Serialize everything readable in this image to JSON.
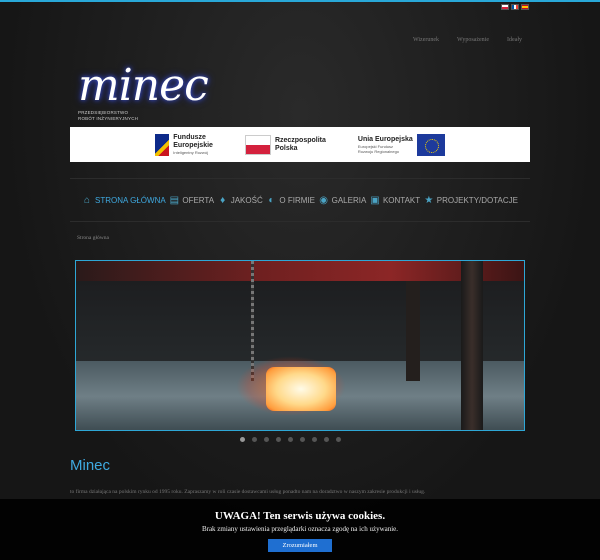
{
  "languages": [
    "pl",
    "fr",
    "es"
  ],
  "top_nav": [
    "Wizerunek",
    "Wyposażenie",
    "Ideały"
  ],
  "logo": {
    "text": "minec",
    "subtitle_line1": "PRZEDSIĘBIORSTWO",
    "subtitle_line2": "ROBÓT INŻYNIERYJNYCH"
  },
  "funds": {
    "fe_title_1": "Fundusze",
    "fe_title_2": "Europejskie",
    "fe_sub": "Inteligentny Rozwój",
    "rp_title_1": "Rzeczpospolita",
    "rp_title_2": "Polska",
    "ue_title": "Unia Europejska",
    "ue_sub_1": "Europejski Fundusz",
    "ue_sub_2": "Rozwoju Regionalnego"
  },
  "main_nav": [
    {
      "label": "STRONA GŁÓWNA",
      "icon": "home-icon",
      "glyph": "⌂"
    },
    {
      "label": "OFERTA",
      "icon": "document-icon",
      "glyph": "▤"
    },
    {
      "label": "JAKOŚĆ",
      "icon": "ribbon-icon",
      "glyph": "♦"
    },
    {
      "label": "O FIRMIE",
      "icon": "globe-icon",
      "glyph": "◐"
    },
    {
      "label": "GALERIA",
      "icon": "eye-icon",
      "glyph": "◉"
    },
    {
      "label": "KONTAKT",
      "icon": "contact-icon",
      "glyph": "▣"
    },
    {
      "label": "PROJEKTY/DOTACJE",
      "icon": "star-icon",
      "glyph": "★"
    }
  ],
  "breadcrumb": "Strona główna",
  "slider": {
    "slide_count": 9,
    "active_index": 0
  },
  "heading": "Minec",
  "intro": "to firma działająca na polskim rynku od 1995 roku. Zapraszamy w roli czasie dostawcami usług ponadto nam na doradztwo w naszym zakresie produkcji i usług.",
  "cookie": {
    "title": "UWAGA! Ten serwis używa cookies.",
    "text": "Brak zmiany ustawienia przeglądarki oznacza zgodę na ich używanie.",
    "button": "Zrozumiałem"
  },
  "colors": {
    "accent": "#3fa9e0",
    "cookie_button": "#1f6fd1"
  }
}
